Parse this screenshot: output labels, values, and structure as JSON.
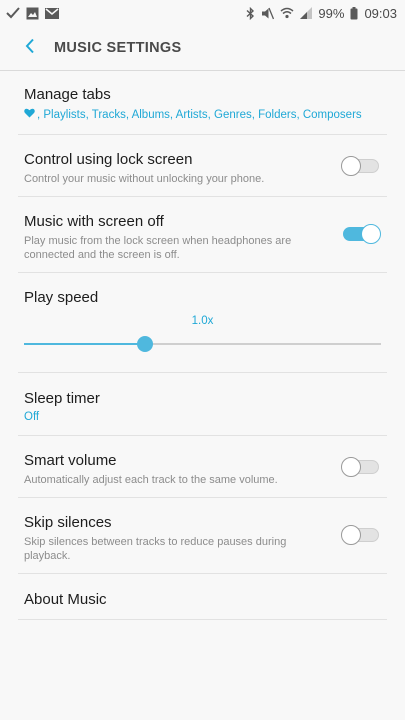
{
  "status_bar": {
    "battery": "99%",
    "time": "09:03",
    "icons_left": [
      "check-icon",
      "image-icon",
      "gmail-icon"
    ],
    "icons_right": [
      "bluetooth-icon",
      "mute-icon",
      "wifi-icon",
      "signal-icon",
      "battery-icon"
    ]
  },
  "header": {
    "title": "MUSIC SETTINGS",
    "back_icon": "chevron-left-icon"
  },
  "settings": {
    "manage_tabs": {
      "title": "Manage tabs",
      "tabs_text": ", Playlists, Tracks, Albums, Artists, Genres, Folders, Composers",
      "favorite_icon": "heart-icon"
    },
    "lock_screen": {
      "title": "Control using lock screen",
      "subtitle": "Control your music without unlocking your phone.",
      "enabled": false
    },
    "screen_off": {
      "title": "Music with screen off",
      "subtitle": "Play music from the lock screen when headphones are connected and the screen is off.",
      "enabled": true
    },
    "play_speed": {
      "title": "Play speed",
      "value_label": "1.0x",
      "position_fraction": 0.34
    },
    "sleep_timer": {
      "title": "Sleep timer",
      "value": "Off"
    },
    "smart_volume": {
      "title": "Smart volume",
      "subtitle": "Automatically adjust each track to the same volume.",
      "enabled": false
    },
    "skip_silences": {
      "title": "Skip silences",
      "subtitle": "Skip silences between tracks to reduce pauses during playback.",
      "enabled": false
    },
    "about": {
      "title": "About Music"
    }
  },
  "colors": {
    "accent": "#1fa8d6",
    "toggle_on": "#4fb8de",
    "background": "#f8f8f8"
  }
}
